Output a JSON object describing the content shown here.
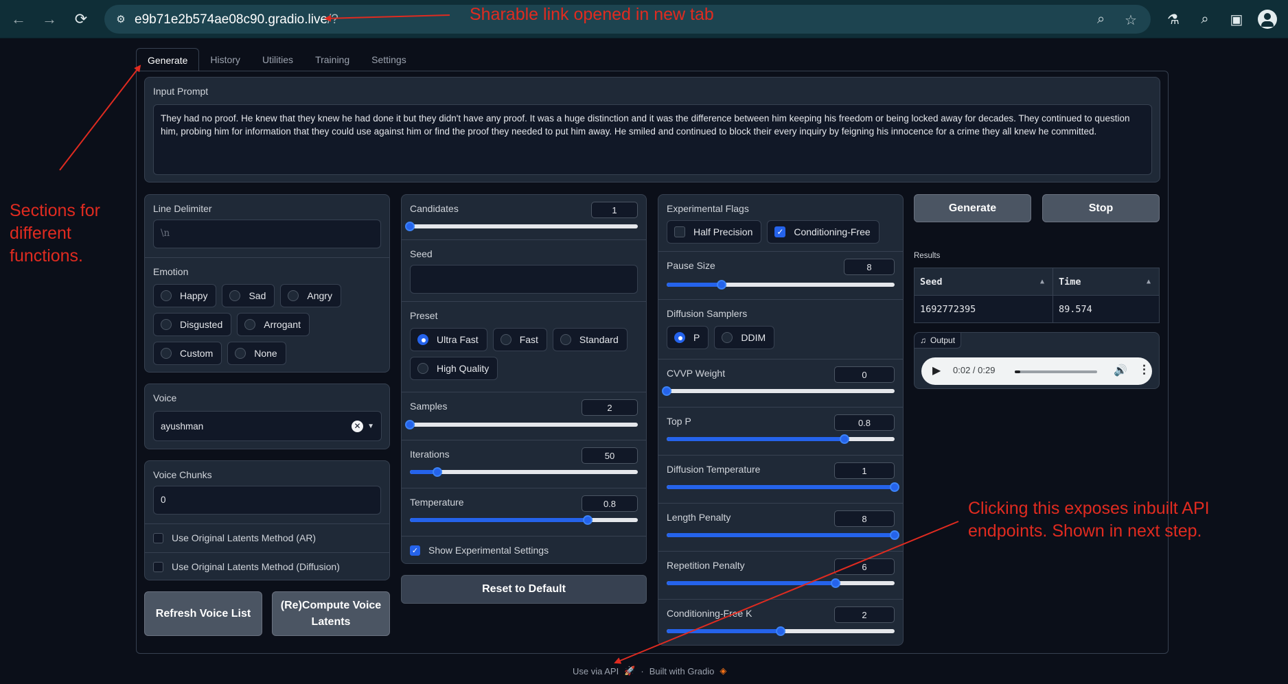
{
  "browser": {
    "url_host": "e9b71e2b574ae08c90.gradio.live",
    "url_path": "/?"
  },
  "tabs": [
    "Generate",
    "History",
    "Utilities",
    "Training",
    "Settings"
  ],
  "input_prompt": {
    "label": "Input Prompt",
    "value": "They had no proof. He knew that they knew he had done it but they didn't have any proof. It was a huge distinction and it was the difference between him keeping his freedom or being locked away for decades. They continued to question him, probing him for information that they could use against him or find the proof they needed to put him away. He smiled and continued to block their every inquiry by feigning his innocence for a crime they all knew he committed."
  },
  "left_col": {
    "line_delimiter": {
      "label": "Line Delimiter",
      "placeholder": "\\n"
    },
    "emotion": {
      "label": "Emotion",
      "options": [
        "Happy",
        "Sad",
        "Angry",
        "Disgusted",
        "Arrogant",
        "Custom",
        "None"
      ]
    },
    "voice": {
      "label": "Voice",
      "value": "ayushman"
    },
    "voice_chunks": {
      "label": "Voice Chunks",
      "value": "0"
    },
    "use_original_latents_ar": "Use Original Latents Method (AR)",
    "use_original_latents_diffusion": "Use Original Latents Method (Diffusion)",
    "refresh_button": "Refresh Voice List",
    "recompute_button": "(Re)Compute Voice Latents"
  },
  "mid_col": {
    "candidates": {
      "label": "Candidates",
      "value": "1",
      "fraction": 0.0
    },
    "seed": {
      "label": "Seed",
      "value": ""
    },
    "preset": {
      "label": "Preset",
      "options": [
        "Ultra Fast",
        "Fast",
        "Standard",
        "High Quality"
      ],
      "selected": "Ultra Fast"
    },
    "samples": {
      "label": "Samples",
      "value": "2",
      "fraction": 0.0
    },
    "iterations": {
      "label": "Iterations",
      "value": "50",
      "fraction": 0.12
    },
    "temperature": {
      "label": "Temperature",
      "value": "0.8",
      "fraction": 0.78
    },
    "show_experimental": "Show Experimental Settings",
    "reset_button": "Reset to Default"
  },
  "right_col": {
    "experimental_flags": {
      "label": "Experimental Flags",
      "half_precision": "Half Precision",
      "conditioning_free": "Conditioning-Free"
    },
    "pause_size": {
      "label": "Pause Size",
      "value": "8",
      "fraction": 0.24
    },
    "diffusion_samplers": {
      "label": "Diffusion Samplers",
      "options": [
        "P",
        "DDIM"
      ],
      "selected": "P"
    },
    "cvvp_weight": {
      "label": "CVVP Weight",
      "value": "0",
      "fraction": 0.0
    },
    "top_p": {
      "label": "Top P",
      "value": "0.8",
      "fraction": 0.78
    },
    "diffusion_temperature": {
      "label": "Diffusion Temperature",
      "value": "1",
      "fraction": 1.0
    },
    "length_penalty": {
      "label": "Length Penalty",
      "value": "8",
      "fraction": 1.0
    },
    "repetition_penalty": {
      "label": "Repetition Penalty",
      "value": "6",
      "fraction": 0.74
    },
    "conditioning_free_k": {
      "label": "Conditioning-Free K",
      "value": "2",
      "fraction": 0.5
    }
  },
  "output_col": {
    "generate_button": "Generate",
    "stop_button": "Stop",
    "results_label": "Results",
    "columns": [
      "Seed",
      "Time"
    ],
    "rows": [
      [
        "1692772395",
        "89.574"
      ]
    ],
    "output_label": "Output",
    "audio_time": "0:02 / 0:29",
    "audio_progress": 0.07
  },
  "footer": {
    "api": "Use via API",
    "built": "Built with Gradio",
    "separator": "·"
  },
  "annotations": {
    "link": "Sharable link opened in new tab",
    "sections": "Sections for different functions.",
    "api_line1": "Clicking this exposes inbuilt API",
    "api_line2": "endpoints. Shown in next step."
  },
  "colors": {
    "annotation": "#e02b20",
    "accent": "#2563eb",
    "browser": "#0f2e37"
  }
}
